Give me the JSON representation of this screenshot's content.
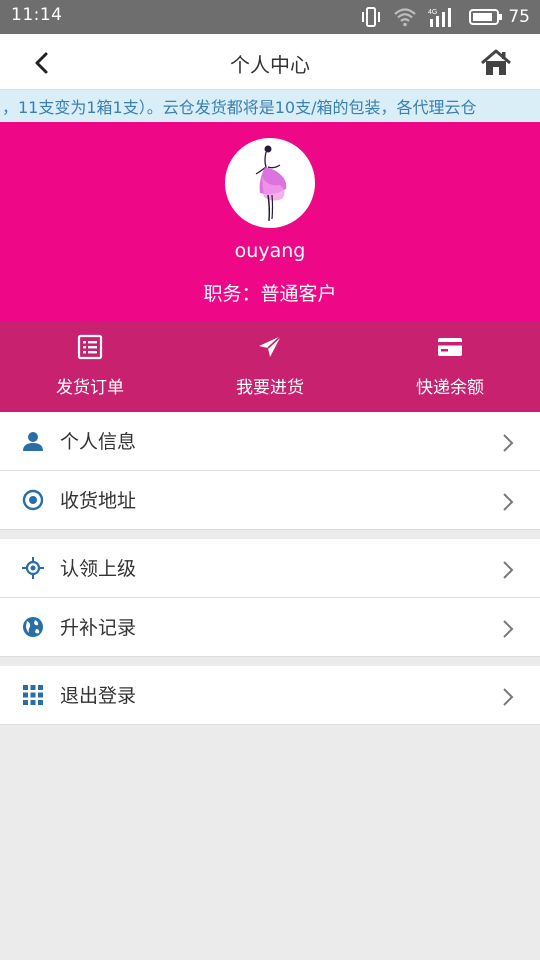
{
  "status_bar": {
    "time": "11:14",
    "battery": "75",
    "network_label": "4G",
    "icons": [
      "vibrate-icon",
      "wifi-icon",
      "signal-icon",
      "battery-icon"
    ]
  },
  "nav": {
    "title": "个人中心",
    "back_icon": "chevron-left-icon",
    "home_icon": "home-icon"
  },
  "announcement": "，11支变为1箱1支）。云仓发货都将是10支/箱的包装，各代理云仓",
  "profile": {
    "username": "ouyang",
    "role": "职务：普通客户"
  },
  "quick_actions": [
    {
      "label": "发货订单",
      "icon": "list-icon"
    },
    {
      "label": "我要进货",
      "icon": "send-icon"
    },
    {
      "label": "快递余额",
      "icon": "card-icon"
    }
  ],
  "menu": {
    "group1": [
      {
        "label": "个人信息",
        "icon": "user-icon"
      },
      {
        "label": "收货地址",
        "icon": "target-icon"
      }
    ],
    "group2": [
      {
        "label": "认领上级",
        "icon": "crosshair-icon"
      },
      {
        "label": "升补记录",
        "icon": "globe-icon"
      }
    ],
    "group3": [
      {
        "label": "退出登录",
        "icon": "grid-icon"
      }
    ]
  },
  "colors": {
    "profile_bg": "#ee0887",
    "quickbar_bg": "#c7216f",
    "icon_blue": "#2a6ea6",
    "marquee_text": "#3a7fb0",
    "marquee_bg": "#d9eef7"
  }
}
